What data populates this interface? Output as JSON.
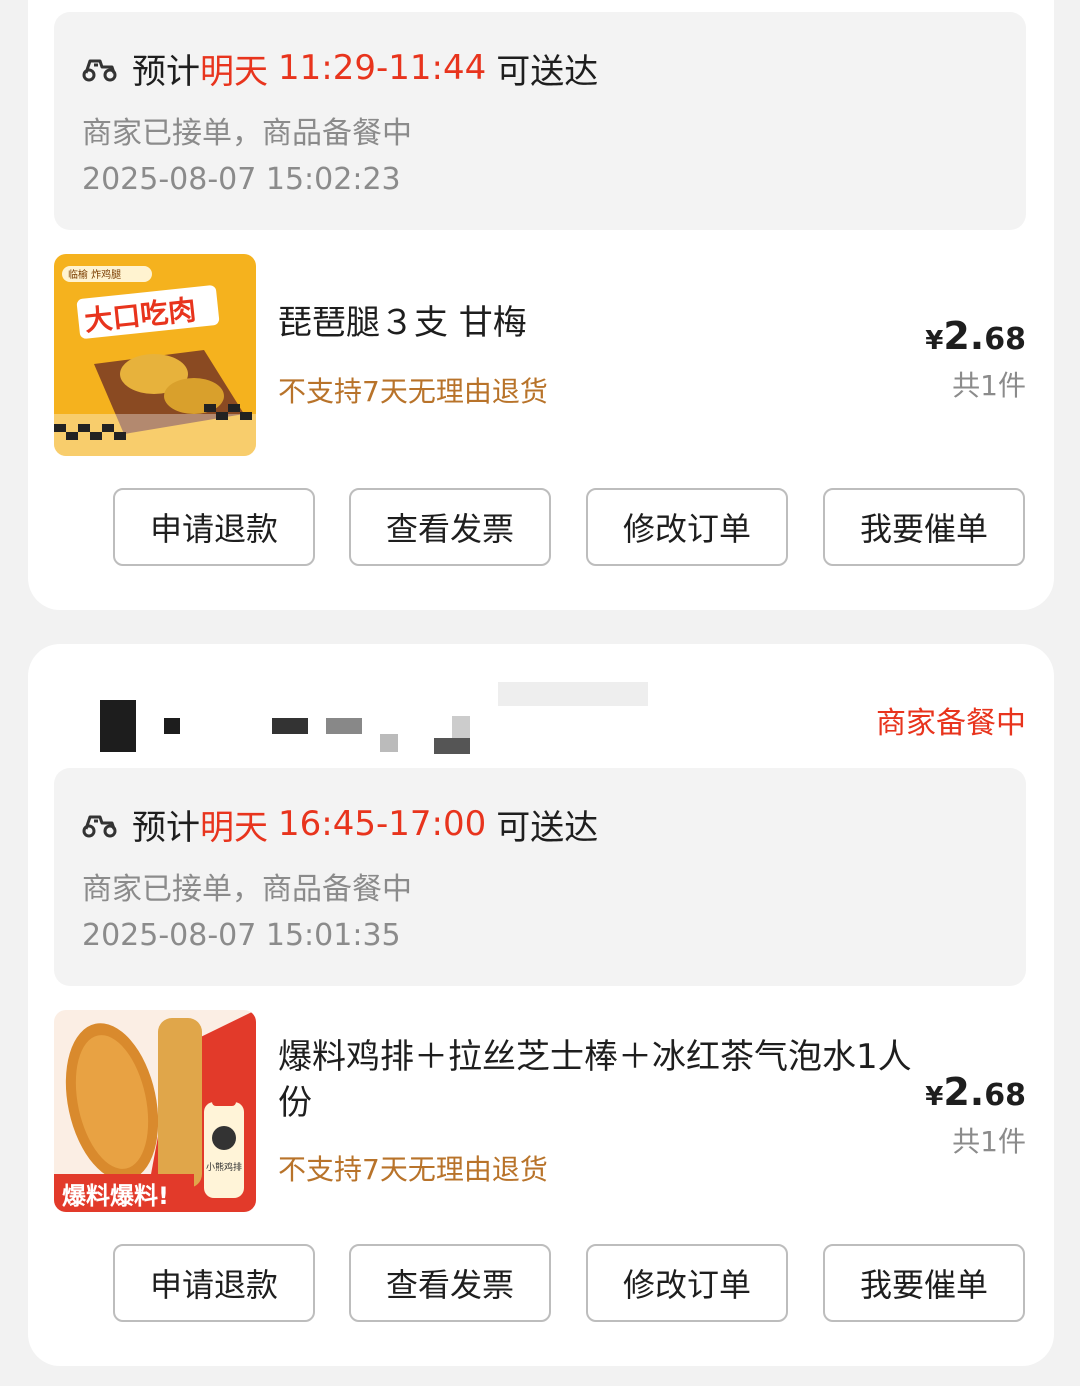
{
  "orders": [
    {
      "eta": {
        "prefix": "预计",
        "day": "明天",
        "window": "11:29-11:44",
        "suffix": "可送达"
      },
      "status_message": "商家已接单，商品备餐中",
      "timestamp": "2025-08-07 15:02:23",
      "item": {
        "name": "琵琶腿３支 甘梅",
        "image_label": "大口吃肉",
        "image_brand": "临榆 炸鸡腿",
        "no_return": "不支持7天无理由退货",
        "price_symbol": "¥",
        "price_int": "2.",
        "price_dec": "68",
        "quantity": "共1件"
      },
      "actions": [
        "申请退款",
        "查看发票",
        "修改订单",
        "我要催单"
      ]
    },
    {
      "order_status": "商家备餐中",
      "eta": {
        "prefix": "预计",
        "day": "明天",
        "window": "16:45-17:00",
        "suffix": "可送达"
      },
      "status_message": "商家已接单，商品备餐中",
      "timestamp": "2025-08-07 15:01:35",
      "item": {
        "name": "爆料鸡排＋拉丝芝士棒＋冰红茶气泡水1人份",
        "image_label": "爆料爆料!",
        "image_brand": "小熊鸡排",
        "no_return": "不支持7天无理由退货",
        "price_symbol": "¥",
        "price_int": "2.",
        "price_dec": "68",
        "quantity": "共1件"
      },
      "actions": [
        "申请退款",
        "查看发票",
        "修改订单",
        "我要催单"
      ]
    }
  ],
  "colors": {
    "accent_red": "#e8341d",
    "warning_brown": "#b8732a",
    "muted_gray": "#8b8b8b"
  },
  "icons": {
    "eta": "scooter-icon"
  }
}
